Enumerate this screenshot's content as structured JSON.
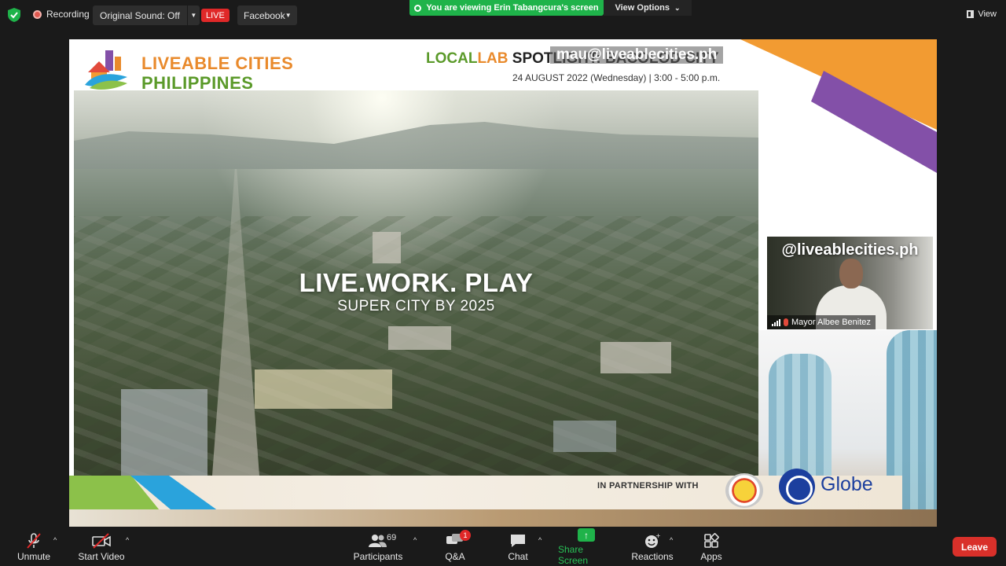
{
  "topbar": {
    "recording_label": "Recording",
    "original_sound_label": "Original Sound: Off",
    "live_label": "LIVE",
    "facebook_label": "Facebook",
    "viewing_banner": "You are viewing Erin Tabangcura's screen",
    "view_options_label": "View Options",
    "view_label": "View"
  },
  "shared_screen": {
    "logo_line1": "LIVEABLE CITIES",
    "logo_line2": "PHILIPPINES",
    "headline_local": "LOCAL",
    "headline_lab": "LAB",
    "headline_rest": " SPOTLIGHT: BACOLOD CITY",
    "watermark_email": "mau@liveablecities.ph",
    "event_date": "24 AUGUST 2022 (Wednesday) | 3:00 - 5:00 p.m.",
    "city_title": "LIVE.WORK. PLAY",
    "city_subtitle": "SUPER CITY BY 2025",
    "partnership_label": "IN PARTNERSHIP WITH",
    "globe_logo": "Globe"
  },
  "speaker_tile": {
    "handle": "@liveablecities.ph",
    "name": "Mayor Albee Benitez"
  },
  "toolbar": {
    "unmute": "Unmute",
    "start_video": "Start Video",
    "participants": "Participants",
    "participants_count": "69",
    "qa": "Q&A",
    "qa_badge": "1",
    "chat": "Chat",
    "share_screen": "Share Screen",
    "reactions": "Reactions",
    "apps": "Apps",
    "leave": "Leave"
  },
  "colors": {
    "accent_green": "#1fb34a",
    "live_red": "#e02828",
    "leave_red": "#d9302a",
    "brand_orange": "#e98a2c",
    "brand_green": "#5b9a2a"
  }
}
